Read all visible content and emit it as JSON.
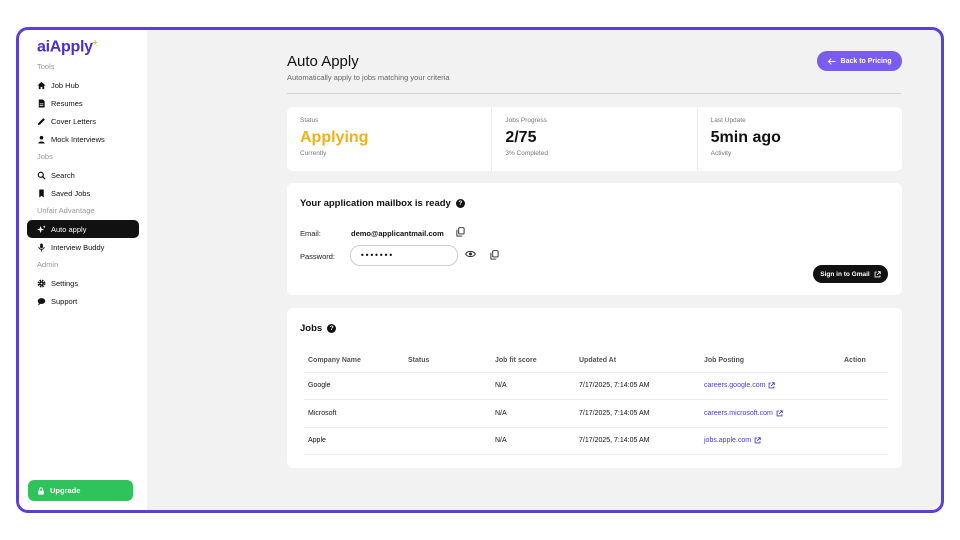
{
  "app": {
    "logo": "aiApply",
    "logo_mark": "+"
  },
  "sidebar": {
    "sections": [
      {
        "label": "Tools",
        "items": [
          {
            "label": "Job Hub",
            "icon": "home-icon"
          },
          {
            "label": "Resumes",
            "icon": "document-icon"
          },
          {
            "label": "Cover Letters",
            "icon": "pen-icon"
          },
          {
            "label": "Mock Interviews",
            "icon": "person-icon"
          }
        ]
      },
      {
        "label": "Jobs",
        "items": [
          {
            "label": "Search",
            "icon": "search-icon"
          },
          {
            "label": "Saved Jobs",
            "icon": "bookmark-icon"
          }
        ]
      },
      {
        "label": "Unfair Advantage",
        "items": [
          {
            "label": "Auto apply",
            "icon": "sparkle-icon",
            "active": true
          },
          {
            "label": "Interview Buddy",
            "icon": "microphone-icon"
          }
        ]
      },
      {
        "label": "Admin",
        "items": [
          {
            "label": "Settings",
            "icon": "gear-icon"
          },
          {
            "label": "Support",
            "icon": "chat-icon"
          }
        ]
      }
    ],
    "upgrade_label": "Upgrade"
  },
  "header": {
    "title": "Auto Apply",
    "subtitle": "Automatically apply to jobs matching your criteria",
    "back_label": "Back to Pricing"
  },
  "stats": {
    "status": {
      "label": "Status",
      "value": "Applying",
      "sub": "Currently"
    },
    "progress": {
      "label": "Jobs Progress",
      "value": "2/75",
      "sub": "3% Completed"
    },
    "update": {
      "label": "Last Update",
      "value": "5min ago",
      "sub": "Activity"
    }
  },
  "mailbox": {
    "title": "Your application mailbox is ready",
    "email_label": "Email:",
    "email_value": "demo@applicantmail.com",
    "password_label": "Password:",
    "password_value": "•••••••",
    "gmail_label": "Sign in to Gmail"
  },
  "jobs": {
    "title": "Jobs",
    "columns": [
      "Company Name",
      "Status",
      "Job fit score",
      "Updated At",
      "Job Posting",
      "Action"
    ],
    "rows": [
      {
        "company": "Google",
        "status": "",
        "score": "N/A",
        "updated": "7/17/2025, 7:14:05 AM",
        "posting": "careers.google.com",
        "action": ""
      },
      {
        "company": "Microsoft",
        "status": "",
        "score": "N/A",
        "updated": "7/17/2025, 7:14:05 AM",
        "posting": "careers.microsoft.com",
        "action": ""
      },
      {
        "company": "Apple",
        "status": "",
        "score": "N/A",
        "updated": "7/17/2025, 7:14:05 AM",
        "posting": "jobs.apple.com",
        "action": ""
      }
    ]
  },
  "colors": {
    "frame": "#5b3fd6",
    "accent": "#7b5cf0",
    "status_yellow": "#f2b019",
    "upgrade_green": "#2fc35c",
    "link": "#4b3bd8"
  }
}
